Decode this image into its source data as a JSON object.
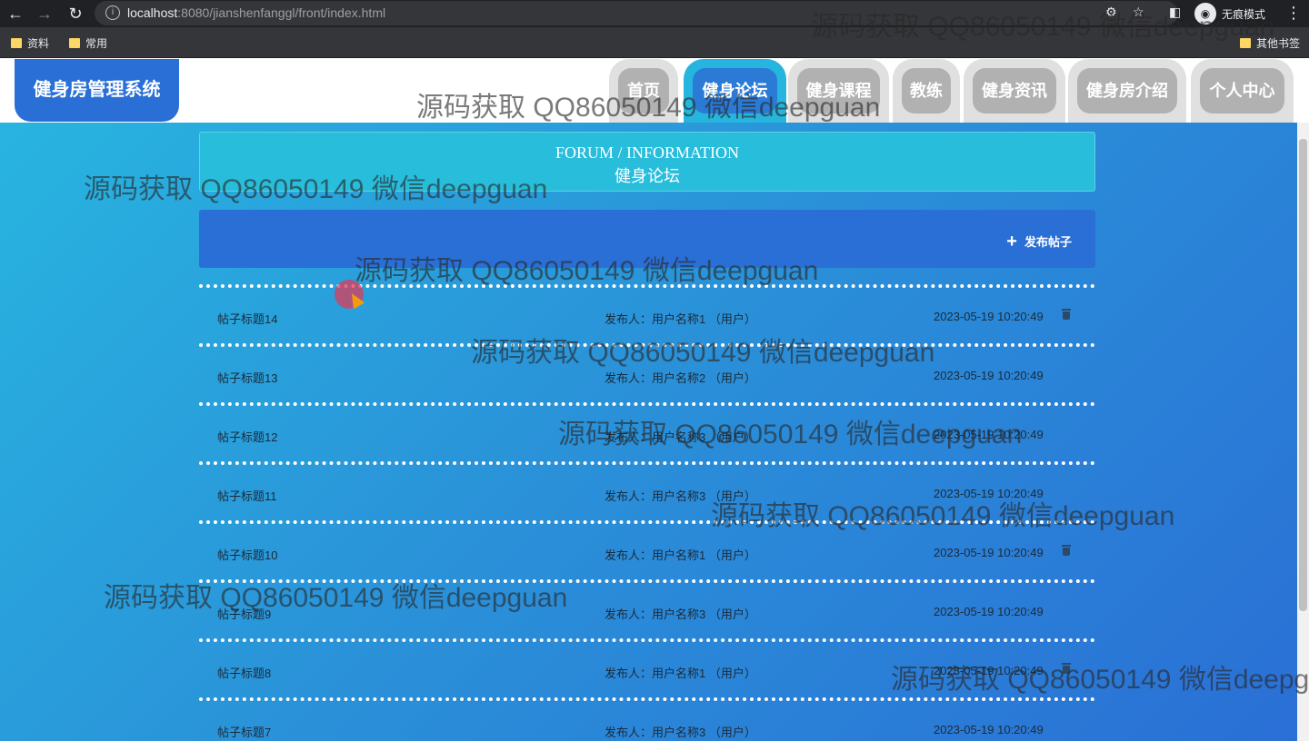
{
  "browser": {
    "url_host": "localhost",
    "url_rest": ":8080/jianshenfanggl/front/index.html",
    "incognito_label": "无痕模式",
    "bookmarks": [
      "资料",
      "常用"
    ],
    "other_bookmarks": "其他书签"
  },
  "header": {
    "logo": "健身房管理系统",
    "nav": [
      "首页",
      "健身论坛",
      "健身课程",
      "教练",
      "健身资讯",
      "健身房介绍",
      "个人中心"
    ],
    "active_index": 1
  },
  "page": {
    "title_en": "FORUM / INFORMATION",
    "title_cn": "健身论坛",
    "publish_label": "发布帖子"
  },
  "posts": [
    {
      "title": "帖子标题14",
      "author": "发布人：用户名称1 （用户）",
      "time": "2023-05-19 10:20:49",
      "deletable": true
    },
    {
      "title": "帖子标题13",
      "author": "发布人：用户名称2 （用户）",
      "time": "2023-05-19 10:20:49",
      "deletable": false
    },
    {
      "title": "帖子标题12",
      "author": "发布人：用户名称3 （用户）",
      "time": "2023-05-19 10:20:49",
      "deletable": false
    },
    {
      "title": "帖子标题11",
      "author": "发布人：用户名称3 （用户）",
      "time": "2023-05-19 10:20:49",
      "deletable": false
    },
    {
      "title": "帖子标题10",
      "author": "发布人：用户名称1 （用户）",
      "time": "2023-05-19 10:20:49",
      "deletable": true
    },
    {
      "title": "帖子标题9",
      "author": "发布人：用户名称3 （用户）",
      "time": "2023-05-19 10:20:49",
      "deletable": false
    },
    {
      "title": "帖子标题8",
      "author": "发布人：用户名称1 （用户）",
      "time": "2023-05-19 10:20:49",
      "deletable": true
    },
    {
      "title": "帖子标题7",
      "author": "发布人：用户名称3 （用户）",
      "time": "2023-05-19 10:20:49",
      "deletable": false
    }
  ],
  "watermark": "源码获取 QQ86050149 微信deepguan"
}
